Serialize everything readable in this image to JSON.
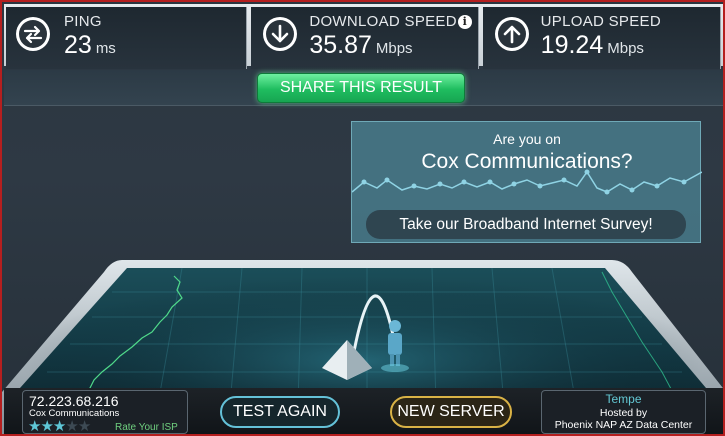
{
  "stats": {
    "ping": {
      "label": "PING",
      "value": "23",
      "unit": "ms",
      "icon": "ping-arrows-icon"
    },
    "download": {
      "label": "DOWNLOAD SPEED",
      "value": "35.87",
      "unit": "Mbps",
      "icon": "arrow-down-icon",
      "info": "i"
    },
    "upload": {
      "label": "UPLOAD SPEED",
      "value": "19.24",
      "unit": "Mbps",
      "icon": "arrow-up-icon"
    }
  },
  "share": {
    "label": "SHARE THIS RESULT"
  },
  "survey": {
    "question_line1": "Are you on",
    "question_line2": "Cox Communications?",
    "button": "Take our Broadband Internet Survey!"
  },
  "isp": {
    "ip": "72.223.68.216",
    "name": "Cox Communications",
    "rating": 3,
    "rating_max": 5,
    "rate_label": "Rate Your ISP"
  },
  "buttons": {
    "test_again": "TEST AGAIN",
    "new_server": "NEW SERVER"
  },
  "server": {
    "city": "Tempe",
    "hosted_label": "Hosted by",
    "name": "Phoenix NAP AZ Data Center"
  },
  "colors": {
    "frame_border": "#b51f1f",
    "share_green": "#1fbd5f",
    "accent_cyan": "#5ec6d6",
    "server_gold": "#d9b246"
  }
}
